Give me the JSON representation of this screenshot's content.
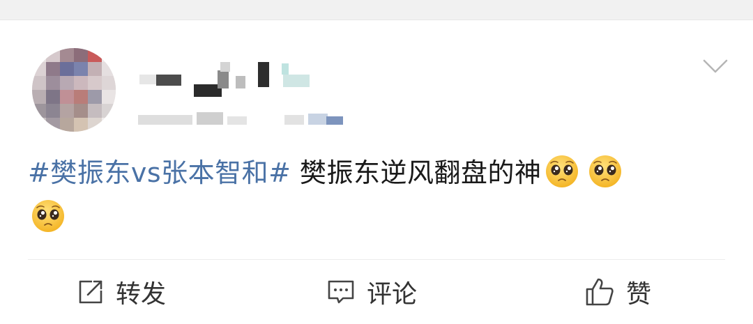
{
  "post": {
    "hashtag": "#樊振东vs张本智和#",
    "text": " 樊振东逆风翻盘的神",
    "emojis": [
      "pleading-face",
      "pleading-face",
      "pleading-face"
    ]
  },
  "actions": {
    "repost_label": "转发",
    "comment_label": "评论",
    "like_label": "赞"
  },
  "colors": {
    "hashtag": "#4a72a6",
    "text": "#1a1a1a",
    "action_text": "#333333",
    "background": "#ffffff",
    "top_strip": "#f1f1f1"
  },
  "icons": {
    "menu": "chevron-down-icon",
    "repost": "repost-icon",
    "comment": "comment-icon",
    "like": "thumbs-up-icon",
    "emoji": "pleading-face-emoji-icon"
  }
}
